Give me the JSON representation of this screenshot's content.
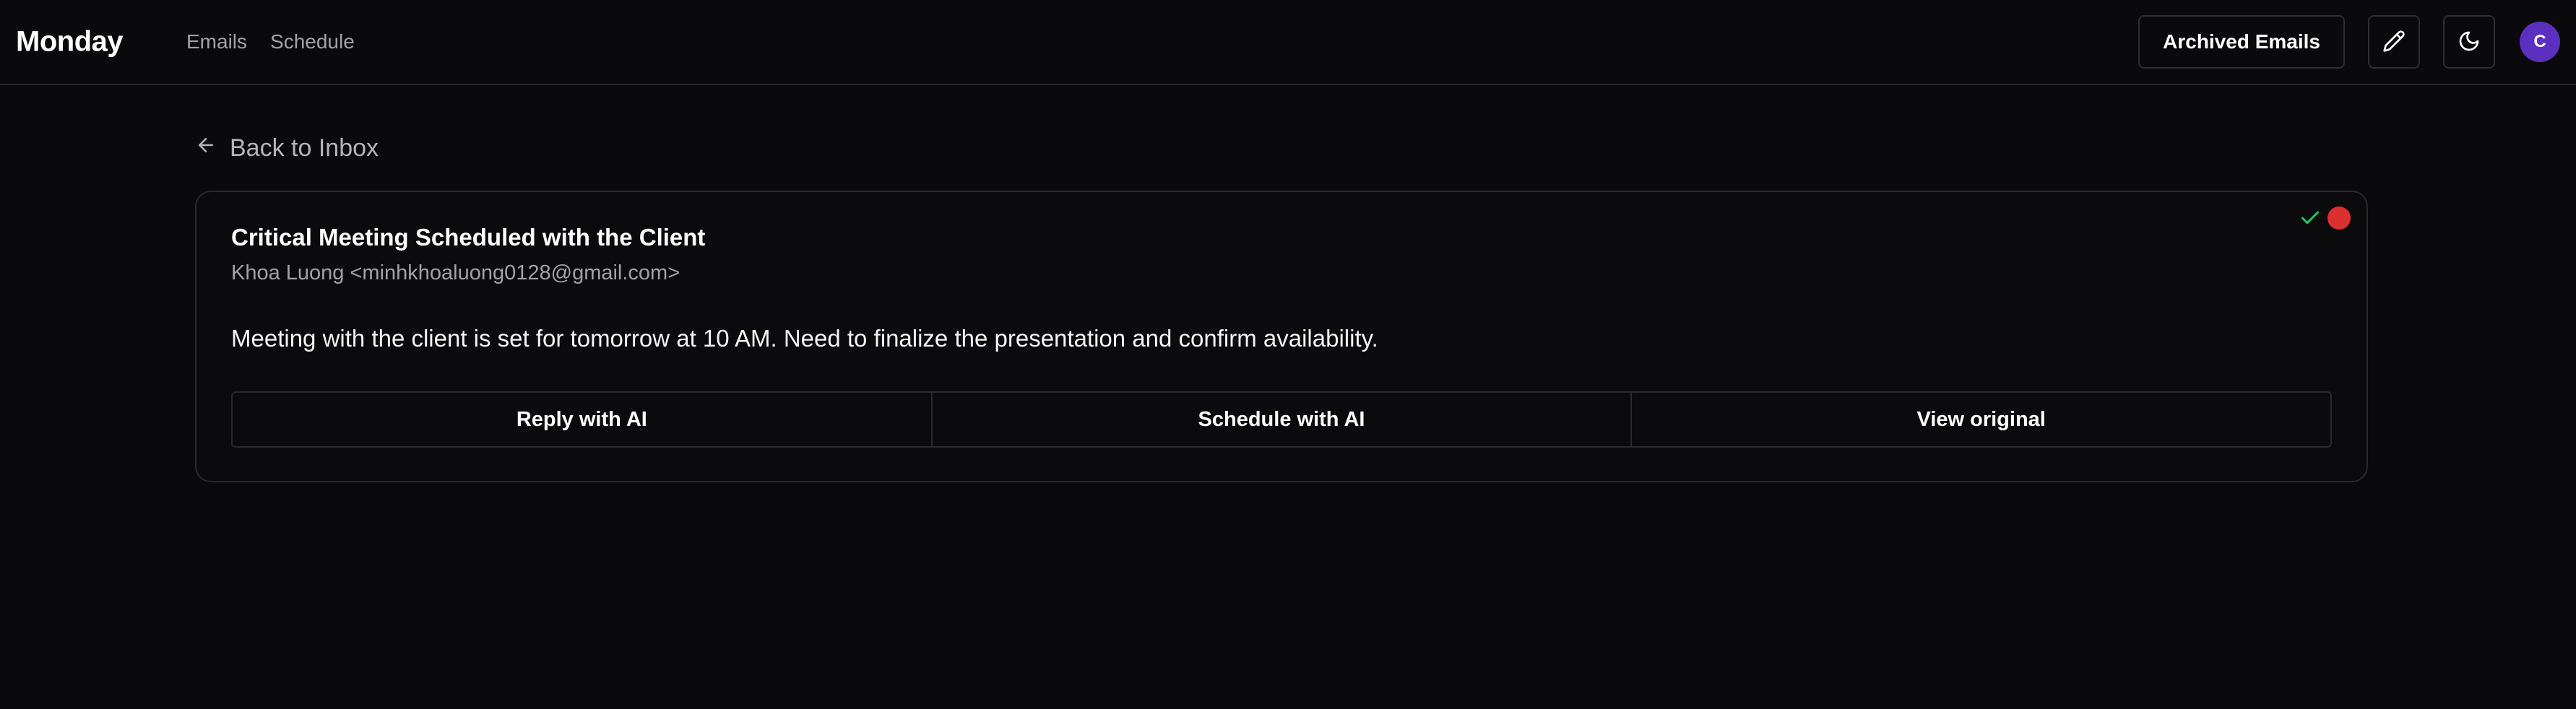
{
  "header": {
    "brand": "Monday",
    "nav": [
      {
        "label": "Emails"
      },
      {
        "label": "Schedule"
      }
    ],
    "archived_label": "Archived Emails",
    "avatar_initial": "C",
    "icons": {
      "compose": "pencil-icon",
      "theme": "moon-icon"
    }
  },
  "back_link": {
    "label": "Back to Inbox",
    "icon": "arrow-left-icon"
  },
  "email": {
    "subject": "Critical Meeting Scheduled with the Client",
    "from": "Khoa Luong <minhkhoaluong0128@gmail.com>",
    "body": "Meeting with the client is set for tomorrow at 10 AM. Need to finalize the presentation and confirm availability.",
    "status_icon": "check-icon",
    "priority_color": "#dc2f2f",
    "actions": [
      {
        "label": "Reply with AI"
      },
      {
        "label": "Schedule with AI"
      },
      {
        "label": "View original"
      }
    ]
  },
  "colors": {
    "background": "#0a0a0c",
    "border": "#2a2a2e",
    "accent_avatar": "#5b2fbf",
    "check_green": "#22c55e"
  }
}
